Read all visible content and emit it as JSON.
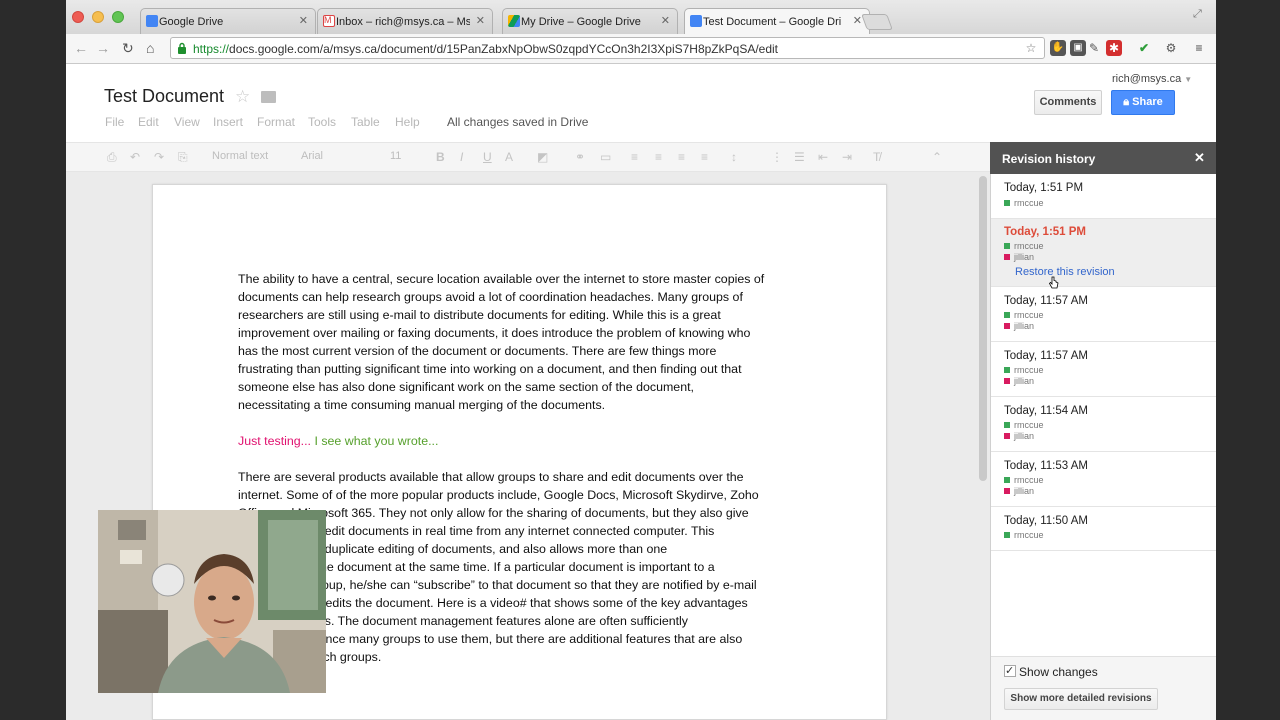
{
  "browser": {
    "tabs": [
      {
        "title": "Google Drive",
        "active": false
      },
      {
        "title": "Inbox – rich@msys.ca – Msy",
        "active": false
      },
      {
        "title": "My Drive – Google Drive",
        "active": false
      },
      {
        "title": "Test Document – Google Dri",
        "active": true
      }
    ],
    "url_scheme": "https://",
    "url_rest": "docs.google.com/a/msys.ca/document/d/15PanZabxNpObwS0zqpdYCcOn3h2I3XpiS7H8pZkPqSA/edit"
  },
  "docs": {
    "title": "Test Document",
    "account": "rich@msys.ca",
    "save_status": "All changes saved in Drive",
    "menu": [
      "File",
      "Edit",
      "View",
      "Insert",
      "Format",
      "Tools",
      "Table",
      "Help"
    ],
    "comments_label": "Comments",
    "share_label": "Share",
    "toolbar": {
      "style": "Normal text",
      "font": "Arial",
      "size": "11"
    }
  },
  "document": {
    "para1_lines": [
      "The ability to have a central, secure location available over the internet to store master copies of",
      "documents can help research groups avoid a lot of coordination headaches. Many groups of",
      "researchers are still using e-mail to distribute documents for editing. While this is a great",
      "improvement over mailing or faxing documents, it does introduce the problem of knowing who",
      "has the most current version of the document or documents.  There are few things more",
      "frustrating than putting significant time into working on a document, and then finding out that",
      "someone else has also done significant work on the same section of the document,",
      "necessitating a time consuming manual merging of the documents."
    ],
    "testing_pink": "Just testing... ",
    "testing_green": "I see what you wrote...",
    "para2_lines": [
      "There are several products available that allow groups to share and edit documents over the",
      "internet. Some of of the more popular products include, Google Docs, Microsoft Skydirve, Zoho",
      "Office and Microsoft 365.  They not only allow for the sharing of documents, but they also give",
      "the ability to co-edit documents in real time from any internet connected computer.  This",
      "helps avoid the duplicate editing of documents, and also allows more than one",
      "person to edit the document at the same time. If a particular document is important to a",
      "member of a group, he/she can “subscribe” to that document so that they are notified by e-mail",
      "when someone edits the document. Here is a video# that shows some of the key advantages",
      "of these services. The document management features alone are often sufficiently",
      "enough to convince many groups to use them, but there are additional features that are also",
      "useful to research groups."
    ]
  },
  "revision_history": {
    "title": "Revision history",
    "restore_label": "Restore this revision",
    "show_changes_label": "Show changes",
    "show_more_label": "Show more detailed revisions",
    "author_colors": {
      "rmccue": "#3aa757",
      "jillian": "#d81b60"
    },
    "revisions": [
      {
        "time": "Today, 1:51 PM",
        "authors": [
          "rmccue"
        ],
        "selected": false
      },
      {
        "time": "Today, 1:51 PM",
        "authors": [
          "rmccue",
          "jillian"
        ],
        "selected": true
      },
      {
        "time": "Today, 11:57 AM",
        "authors": [
          "rmccue",
          "jillian"
        ],
        "selected": false
      },
      {
        "time": "Today, 11:57 AM",
        "authors": [
          "rmccue",
          "jillian"
        ],
        "selected": false
      },
      {
        "time": "Today, 11:54 AM",
        "authors": [
          "rmccue",
          "jillian"
        ],
        "selected": false
      },
      {
        "time": "Today, 11:53 AM",
        "authors": [
          "rmccue",
          "jillian"
        ],
        "selected": false
      },
      {
        "time": "Today, 11:50 AM",
        "authors": [
          "rmccue"
        ],
        "selected": false
      }
    ]
  }
}
